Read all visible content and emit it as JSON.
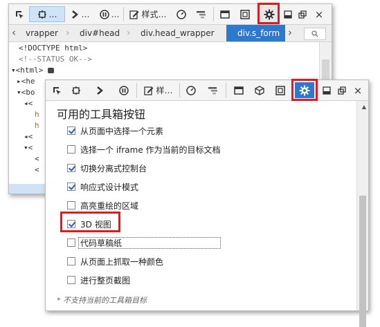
{
  "back_window": {
    "toolbar": {
      "more_dots_1": "…",
      "more_dots_2": "…",
      "more_dots_3": "…",
      "style_label": "样式…",
      "close_glyph": "×"
    },
    "breadcrumb": [
      "vrapper",
      "div#head",
      "div.head_wrapper",
      "div.s_form"
    ],
    "code_lines": [
      "<!DOCTYPE html>",
      "<!--STATUS OK-->",
      "<html>",
      "<he",
      "<bo",
      "<",
      "h",
      "h",
      "<",
      "<",
      "<",
      "<"
    ]
  },
  "front_window": {
    "toolbar": {
      "style_label": "样…",
      "close_glyph": "×"
    },
    "heading": "可用的工具箱按钮",
    "options": [
      {
        "label": "从页面中选择一个元素",
        "checked": true
      },
      {
        "label": "选择一个 iframe 作为当前的目标文档",
        "checked": false
      },
      {
        "label": "切换分离式控制台",
        "checked": true
      },
      {
        "label": "响应式设计模式",
        "checked": true
      },
      {
        "label": "高亮重绘的区域",
        "checked": false
      },
      {
        "label": "3D 视图",
        "checked": true
      },
      {
        "label": "代码草稿纸",
        "checked": false
      },
      {
        "label": "从页面上抓取一种颜色",
        "checked": false
      },
      {
        "label": "进行整页截图",
        "checked": false
      }
    ],
    "footnote": "* 不支持当前的工具箱目标"
  },
  "colors": {
    "accent": "#2c79cf",
    "highlight_red": "#e01a1a",
    "selected_bg": "#cfe3f7"
  },
  "icons": [
    "pick-element-icon",
    "responsive-icon",
    "console-icon",
    "debugger-icon",
    "style-editor-icon",
    "profiler-icon",
    "network-icon",
    "scratchpad-icon",
    "3d-view-icon",
    "screenshot-icon",
    "gear-icon",
    "dock-bottom-icon",
    "undock-icon",
    "close-icon"
  ]
}
